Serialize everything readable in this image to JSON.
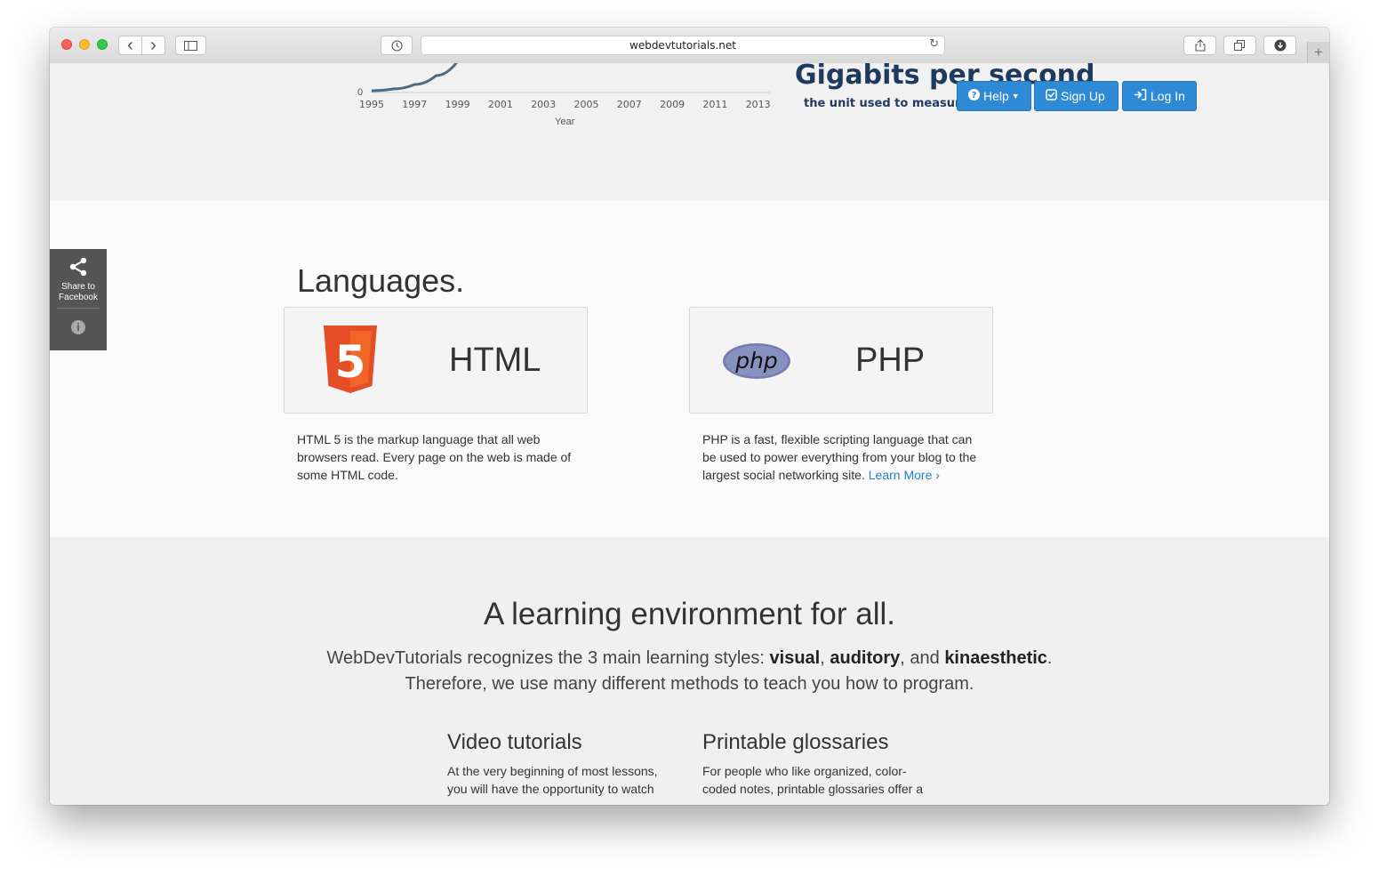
{
  "browser": {
    "url": "webdevtutorials.net",
    "back_icon": "‹",
    "forward_icon": "›",
    "reload_icon": "↻",
    "new_tab_icon": "+"
  },
  "chart_data": {
    "type": "line",
    "x": [
      1995,
      1996,
      1997,
      1998,
      1999
    ],
    "y_visible_min": 0,
    "xticks": [
      "1995",
      "1997",
      "1999",
      "2001",
      "2003",
      "2005",
      "2007",
      "2009",
      "2011",
      "2013"
    ],
    "xlabel": "Year",
    "ytick_visible": "0",
    "line_color": "#4a6a85"
  },
  "promo": {
    "title": "Gigabits per second",
    "subtitle": "the unit used to measure"
  },
  "nav": {
    "help_label": "Help",
    "signup_label": "Sign Up",
    "login_label": "Log In",
    "accent": "#2f8ad6"
  },
  "share": {
    "label_line1": "Share to",
    "label_line2": "Facebook",
    "info_glyph": "i"
  },
  "languages": {
    "heading": "Languages.",
    "items": [
      {
        "name": "HTML",
        "logo": "html5-logo",
        "logo_text": "5",
        "description": "HTML 5 is the markup language that all web browsers read. Every page on the web is made of some HTML code.",
        "link": ""
      },
      {
        "name": "PHP",
        "logo": "php-logo",
        "logo_text": "php",
        "description": "PHP is a fast, flexible scripting language that can be used to power everything from your blog to the largest social networking site.",
        "link": "Learn More ›"
      }
    ]
  },
  "learning": {
    "heading": "A learning environment for all.",
    "line1_prefix": "WebDevTutorials recognizes the 3 main learning styles: ",
    "style_visual": "visual",
    "sep1": ", ",
    "style_auditory": "auditory",
    "sep2": ", and ",
    "style_kinaesthetic": "kinaesthetic",
    "line1_end": ".",
    "line2": "Therefore, we use many different methods to teach you how to program.",
    "features": [
      {
        "title": "Video tutorials",
        "description": "At the very beginning of most lessons, you will have the opportunity to watch"
      },
      {
        "title": "Printable glossaries",
        "description": "For people who like organized, color-coded notes, printable glossaries offer a"
      }
    ]
  }
}
